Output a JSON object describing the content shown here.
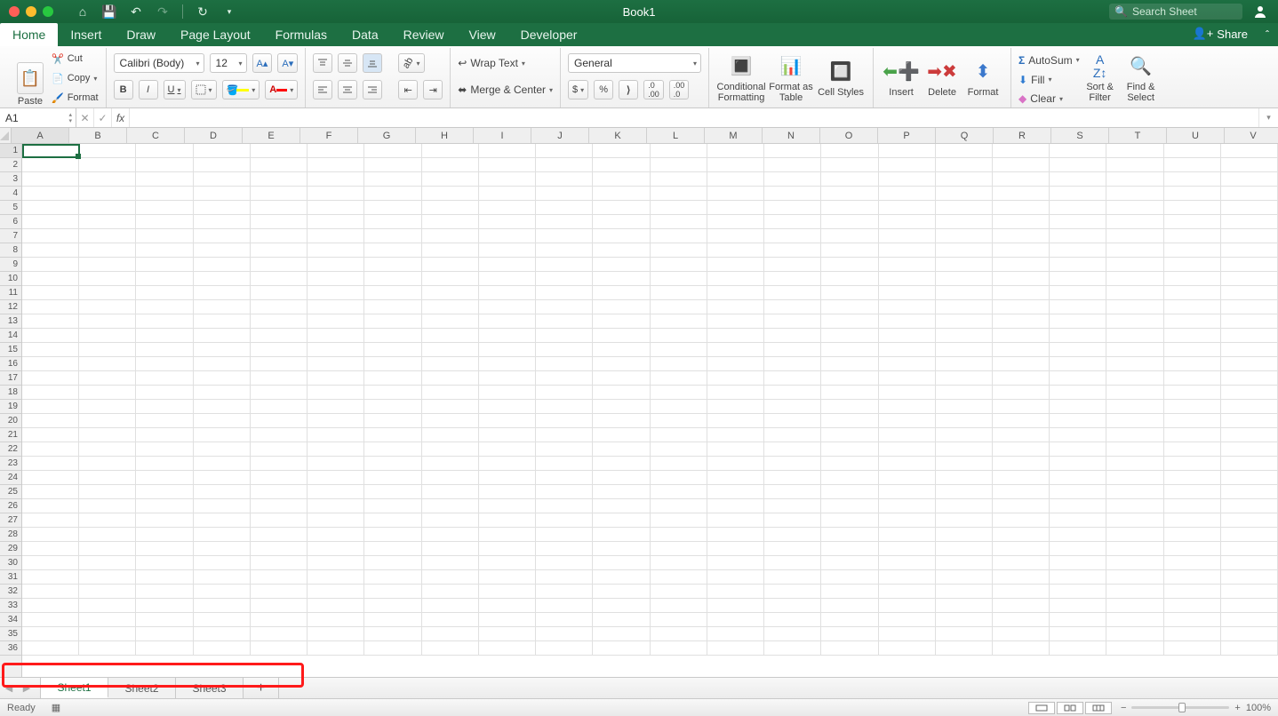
{
  "window": {
    "title": "Book1",
    "search_placeholder": "Search Sheet"
  },
  "tabs": [
    "Home",
    "Insert",
    "Draw",
    "Page Layout",
    "Formulas",
    "Data",
    "Review",
    "View",
    "Developer"
  ],
  "active_tab": "Home",
  "share_label": "Share",
  "ribbon": {
    "clipboard": {
      "paste": "Paste",
      "cut": "Cut",
      "copy": "Copy",
      "format": "Format"
    },
    "font": {
      "name": "Calibri (Body)",
      "size": "12",
      "bold": "B",
      "italic": "I",
      "underline": "U"
    },
    "alignment": {
      "wrap": "Wrap Text",
      "merge": "Merge & Center"
    },
    "number": {
      "format": "General"
    },
    "styles": {
      "cond": "Conditional Formatting",
      "table": "Format as Table",
      "cell": "Cell Styles"
    },
    "cells": {
      "insert": "Insert",
      "delete": "Delete",
      "format": "Format"
    },
    "editing": {
      "autosum": "AutoSum",
      "fill": "Fill",
      "clear": "Clear",
      "sort": "Sort & Filter",
      "find": "Find & Select"
    }
  },
  "namebox": "A1",
  "formula": "",
  "columns": [
    "A",
    "B",
    "C",
    "D",
    "E",
    "F",
    "G",
    "H",
    "I",
    "J",
    "K",
    "L",
    "M",
    "N",
    "O",
    "P",
    "Q",
    "R",
    "S",
    "T",
    "U",
    "V"
  ],
  "rows": 36,
  "sheets": [
    "Sheet1",
    "Sheet2",
    "Sheet3"
  ],
  "active_sheet": "Sheet1",
  "status": {
    "ready": "Ready",
    "zoom": "100%"
  }
}
